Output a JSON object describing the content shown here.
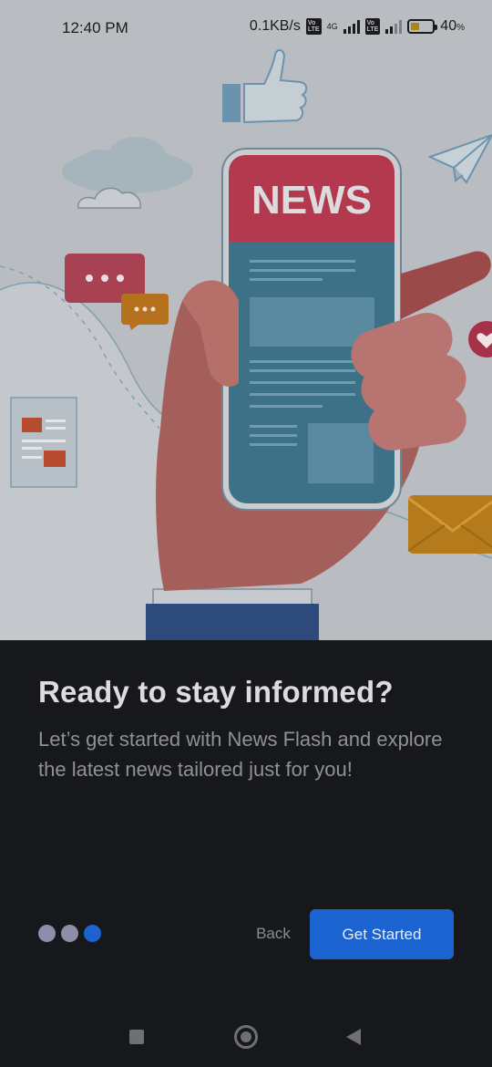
{
  "status_bar": {
    "time": "12:40 PM",
    "network_speed": "0.1KB/s",
    "network_type": "4G",
    "volte_label": "Vo\nLTE",
    "battery_percent": "40",
    "battery_suffix": "%",
    "battery_level": 0.4
  },
  "illustration": {
    "phone_screen_title": "NEWS"
  },
  "onboarding": {
    "headline": "Ready to stay informed?",
    "subtitle": "Let’s get started with News Flash and explore the latest news tailored just for you!",
    "page_count": 3,
    "current_page": 3
  },
  "buttons": {
    "back_label": "Back",
    "get_started_label": "Get Started"
  },
  "colors": {
    "background": "#17181c",
    "accent": "#1c63d2",
    "illustration_bg": "#b9bcc1"
  },
  "icons": [
    "square-recents-icon",
    "home-circle-icon",
    "back-triangle-icon",
    "thumbs-up-icon",
    "paper-plane-icon",
    "heart-icon",
    "envelope-icon",
    "chat-bubble-icon"
  ]
}
